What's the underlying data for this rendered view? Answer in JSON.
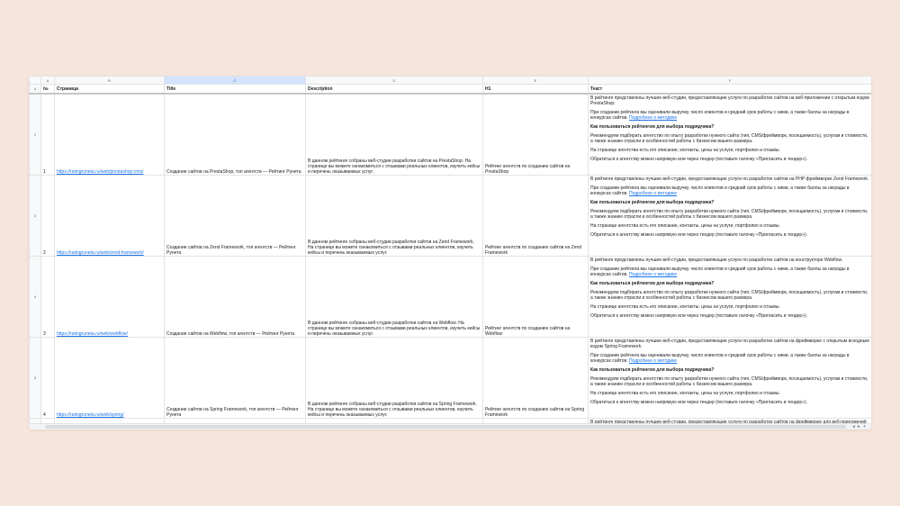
{
  "columns": [
    "",
    "A",
    "B",
    "C",
    "D",
    "E",
    "F"
  ],
  "header_row": {
    "num": "1",
    "cells": [
      "№",
      "Страница",
      "Title",
      "Description",
      "H1",
      "Текст"
    ]
  },
  "rows": [
    {
      "num": "2",
      "id": "1",
      "url": "https://ratingruneta.ru/web/prestashop-cms/",
      "title": "Создание сайтов на PrestaShop, топ агентств — Рейтинг Рунета",
      "description": "В данном рейтинге собраны веб-студии разработки сайтов на PrestaShop. На странице вы можете ознакомиться с отзывами реальных клиентов, изучить кейсы и перечень оказываемых услуг.",
      "h1": "Рейтинг агентств по созданию сайтов на PrestaShop",
      "text": {
        "p1": "В рейтинге представлены лучшие веб-студии, предоставляющие услуги по разработке сайтов на веб-приложении с открытым кодом PrestaShop.",
        "p2": "При создании рейтинга мы оценивали выручку, число клиентов и средний срок работы с ними, а также баллы за награды в конкурсах сайтов.",
        "link": "Подробнее о методике",
        "q": "Как пользоваться рейтингом для выбора подрядчика?",
        "p3": "Рекомендуем подбирать агентство по опыту разработки нужного сайта (тип, CMS/фреймворк, посещаемость), услугам и стоимости, а также знанию отрасли и особенностей работы с бизнесом вашего размера.",
        "p4": "На странице агентства есть его описание, контакты, цены на услуги, портфолио и отзывы.",
        "p5": "Обратиться к агентству можно напрямую или через тендер (поставьте галочку «Пригласить в тендер»)."
      }
    },
    {
      "num": "3",
      "id": "2",
      "url": "https://ratingruneta.ru/web/zend-framework/",
      "title": "Создание сайтов на Zend Framework, топ агентств — Рейтинг Рунета",
      "description": "В данном рейтинге собраны веб-студии разработки сайтов на Zend Framework. На странице вы можете ознакомиться с отзывами реальных клиентов, изучить кейсы и перечень оказываемых услуг.",
      "h1": "Рейтинг агентств по созданию сайтов на Zend Framework",
      "text": {
        "p1": "В рейтинге представлены лучшие веб-студии, предоставляющие услуги по разработке сайтов на PHP фреймворке Zend Framework.",
        "p2": "При создании рейтинга мы оценивали выручку, число клиентов и средний срок работы с ними, а также баллы за награды в конкурсах сайтов.",
        "link": "Подробнее о методике",
        "q": "Как пользоваться рейтингом для выбора подрядчика?",
        "p3": "Рекомендуем подбирать агентство по опыту разработки нужного сайта (тип, CMS/фреймворк, посещаемость), услугам и стоимости, а также знанию отрасли и особенностей работы с бизнесом вашего размера.",
        "p4": "На странице агентства есть его описание, контакты, цены на услуги, портфолио и отзывы.",
        "p5": "Обратиться к агентству можно напрямую или через тендер (поставьте галочку «Пригласить в тендер»)."
      }
    },
    {
      "num": "4",
      "id": "3",
      "url": "https://ratingruneta.ru/web/webflow/",
      "title": "Создание сайтов на Webflow, топ агентств — Рейтинг Рунета",
      "description": "В данном рейтинге собраны веб-студии разработки сайтов на Webflow. На странице вы можете ознакомиться с отзывами реальных клиентов, изучить кейсы и перечень оказываемых услуг.",
      "h1": "Рейтинг агентств по созданию сайтов на Webflow",
      "text": {
        "p1": "В рейтинге представлены лучшие веб-студии, предоставляющие услуги по разработке сайтов на конструкторе Webflow.",
        "p2": "При создании рейтинга мы оценивали выручку, число клиентов и средний срок работы с ними, а также баллы за награды в конкурсах сайтов.",
        "link": "Подробнее о методике",
        "q": "Как пользоваться рейтингом для выбора подрядчика?",
        "p3": "Рекомендуем подбирать агентство по опыту разработки нужного сайта (тип, CMS/фреймворк, посещаемость), услугам и стоимости, а также знанию отрасли и особенностей работы с бизнесом вашего размера.",
        "p4": "На странице агентства есть его описание, контакты, цены на услуги, портфолио и отзывы.",
        "p5": "Обратиться к агентству можно напрямую или через тендер (поставьте галочку «Пригласить в тендер»)."
      }
    },
    {
      "num": "5",
      "id": "4",
      "url": "https://ratingruneta.ru/web/spring/",
      "title": "Создание сайтов на Spring Framework, топ агентств — Рейтинг Рунета",
      "description": "В данном рейтинге собраны веб-студии разработки сайтов на Spring Framework. На странице вы можете ознакомиться с отзывами реальных клиентов, изучить кейсы и перечень оказываемых услуг.",
      "h1": "Рейтинг агентств по созданию сайтов на Spring Framework",
      "text": {
        "p1": "В рейтинге представлены лучшие веб-студии, предоставляющие услуги по разработке сайтов на фреймворке с открытым исходным кодом Spring Framework.",
        "p2": "При создании рейтинга мы оценивали выручку, число клиентов и средний срок работы с ними, а также баллы за награды в конкурсах сайтов.",
        "link": "Подробнее о методике",
        "q": "Как пользоваться рейтингом для выбора подрядчика?",
        "p3": "Рекомендуем подбирать агентство по опыту разработки нужного сайта (тип, CMS/фреймворк, посещаемость), услугам и стоимости, а также знанию отрасли и особенностей работы с бизнесом вашего размера.",
        "p4": "На странице агентства есть его описание, контакты, цены на услуги, портфолио и отзывы.",
        "p5": "Обратиться к агентству можно напрямую или через тендер (поставьте галочку «Пригласить в тендер»)."
      }
    }
  ],
  "partial_row": {
    "text": "В рейтинге представлены лучшие веб-студии, предоставляющие услуги по разработке сайтов на фреймворке для веб-приложений Express.js."
  },
  "scroll_arrows": [
    "◂",
    "▸",
    "+"
  ]
}
